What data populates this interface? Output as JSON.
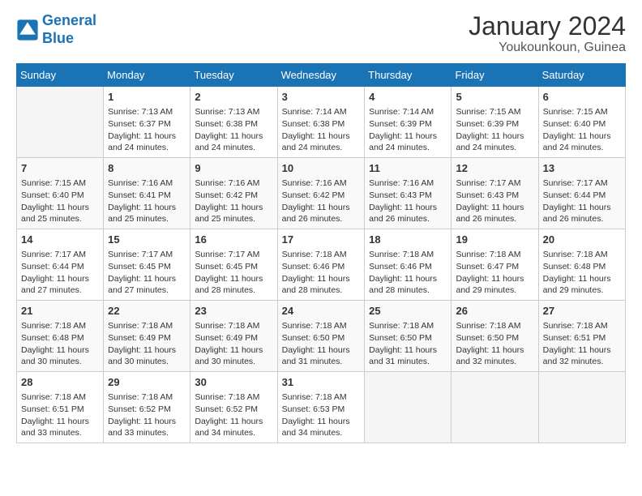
{
  "header": {
    "logo_line1": "General",
    "logo_line2": "Blue",
    "title": "January 2024",
    "subtitle": "Youkounkoun, Guinea"
  },
  "days_of_week": [
    "Sunday",
    "Monday",
    "Tuesday",
    "Wednesday",
    "Thursday",
    "Friday",
    "Saturday"
  ],
  "weeks": [
    [
      {
        "day": "",
        "sunrise": "",
        "sunset": "",
        "daylight": ""
      },
      {
        "day": "1",
        "sunrise": "Sunrise: 7:13 AM",
        "sunset": "Sunset: 6:37 PM",
        "daylight": "Daylight: 11 hours and 24 minutes."
      },
      {
        "day": "2",
        "sunrise": "Sunrise: 7:13 AM",
        "sunset": "Sunset: 6:38 PM",
        "daylight": "Daylight: 11 hours and 24 minutes."
      },
      {
        "day": "3",
        "sunrise": "Sunrise: 7:14 AM",
        "sunset": "Sunset: 6:38 PM",
        "daylight": "Daylight: 11 hours and 24 minutes."
      },
      {
        "day": "4",
        "sunrise": "Sunrise: 7:14 AM",
        "sunset": "Sunset: 6:39 PM",
        "daylight": "Daylight: 11 hours and 24 minutes."
      },
      {
        "day": "5",
        "sunrise": "Sunrise: 7:15 AM",
        "sunset": "Sunset: 6:39 PM",
        "daylight": "Daylight: 11 hours and 24 minutes."
      },
      {
        "day": "6",
        "sunrise": "Sunrise: 7:15 AM",
        "sunset": "Sunset: 6:40 PM",
        "daylight": "Daylight: 11 hours and 24 minutes."
      }
    ],
    [
      {
        "day": "7",
        "sunrise": "Sunrise: 7:15 AM",
        "sunset": "Sunset: 6:40 PM",
        "daylight": "Daylight: 11 hours and 25 minutes."
      },
      {
        "day": "8",
        "sunrise": "Sunrise: 7:16 AM",
        "sunset": "Sunset: 6:41 PM",
        "daylight": "Daylight: 11 hours and 25 minutes."
      },
      {
        "day": "9",
        "sunrise": "Sunrise: 7:16 AM",
        "sunset": "Sunset: 6:42 PM",
        "daylight": "Daylight: 11 hours and 25 minutes."
      },
      {
        "day": "10",
        "sunrise": "Sunrise: 7:16 AM",
        "sunset": "Sunset: 6:42 PM",
        "daylight": "Daylight: 11 hours and 26 minutes."
      },
      {
        "day": "11",
        "sunrise": "Sunrise: 7:16 AM",
        "sunset": "Sunset: 6:43 PM",
        "daylight": "Daylight: 11 hours and 26 minutes."
      },
      {
        "day": "12",
        "sunrise": "Sunrise: 7:17 AM",
        "sunset": "Sunset: 6:43 PM",
        "daylight": "Daylight: 11 hours and 26 minutes."
      },
      {
        "day": "13",
        "sunrise": "Sunrise: 7:17 AM",
        "sunset": "Sunset: 6:44 PM",
        "daylight": "Daylight: 11 hours and 26 minutes."
      }
    ],
    [
      {
        "day": "14",
        "sunrise": "Sunrise: 7:17 AM",
        "sunset": "Sunset: 6:44 PM",
        "daylight": "Daylight: 11 hours and 27 minutes."
      },
      {
        "day": "15",
        "sunrise": "Sunrise: 7:17 AM",
        "sunset": "Sunset: 6:45 PM",
        "daylight": "Daylight: 11 hours and 27 minutes."
      },
      {
        "day": "16",
        "sunrise": "Sunrise: 7:17 AM",
        "sunset": "Sunset: 6:45 PM",
        "daylight": "Daylight: 11 hours and 28 minutes."
      },
      {
        "day": "17",
        "sunrise": "Sunrise: 7:18 AM",
        "sunset": "Sunset: 6:46 PM",
        "daylight": "Daylight: 11 hours and 28 minutes."
      },
      {
        "day": "18",
        "sunrise": "Sunrise: 7:18 AM",
        "sunset": "Sunset: 6:46 PM",
        "daylight": "Daylight: 11 hours and 28 minutes."
      },
      {
        "day": "19",
        "sunrise": "Sunrise: 7:18 AM",
        "sunset": "Sunset: 6:47 PM",
        "daylight": "Daylight: 11 hours and 29 minutes."
      },
      {
        "day": "20",
        "sunrise": "Sunrise: 7:18 AM",
        "sunset": "Sunset: 6:48 PM",
        "daylight": "Daylight: 11 hours and 29 minutes."
      }
    ],
    [
      {
        "day": "21",
        "sunrise": "Sunrise: 7:18 AM",
        "sunset": "Sunset: 6:48 PM",
        "daylight": "Daylight: 11 hours and 30 minutes."
      },
      {
        "day": "22",
        "sunrise": "Sunrise: 7:18 AM",
        "sunset": "Sunset: 6:49 PM",
        "daylight": "Daylight: 11 hours and 30 minutes."
      },
      {
        "day": "23",
        "sunrise": "Sunrise: 7:18 AM",
        "sunset": "Sunset: 6:49 PM",
        "daylight": "Daylight: 11 hours and 30 minutes."
      },
      {
        "day": "24",
        "sunrise": "Sunrise: 7:18 AM",
        "sunset": "Sunset: 6:50 PM",
        "daylight": "Daylight: 11 hours and 31 minutes."
      },
      {
        "day": "25",
        "sunrise": "Sunrise: 7:18 AM",
        "sunset": "Sunset: 6:50 PM",
        "daylight": "Daylight: 11 hours and 31 minutes."
      },
      {
        "day": "26",
        "sunrise": "Sunrise: 7:18 AM",
        "sunset": "Sunset: 6:50 PM",
        "daylight": "Daylight: 11 hours and 32 minutes."
      },
      {
        "day": "27",
        "sunrise": "Sunrise: 7:18 AM",
        "sunset": "Sunset: 6:51 PM",
        "daylight": "Daylight: 11 hours and 32 minutes."
      }
    ],
    [
      {
        "day": "28",
        "sunrise": "Sunrise: 7:18 AM",
        "sunset": "Sunset: 6:51 PM",
        "daylight": "Daylight: 11 hours and 33 minutes."
      },
      {
        "day": "29",
        "sunrise": "Sunrise: 7:18 AM",
        "sunset": "Sunset: 6:52 PM",
        "daylight": "Daylight: 11 hours and 33 minutes."
      },
      {
        "day": "30",
        "sunrise": "Sunrise: 7:18 AM",
        "sunset": "Sunset: 6:52 PM",
        "daylight": "Daylight: 11 hours and 34 minutes."
      },
      {
        "day": "31",
        "sunrise": "Sunrise: 7:18 AM",
        "sunset": "Sunset: 6:53 PM",
        "daylight": "Daylight: 11 hours and 34 minutes."
      },
      {
        "day": "",
        "sunrise": "",
        "sunset": "",
        "daylight": ""
      },
      {
        "day": "",
        "sunrise": "",
        "sunset": "",
        "daylight": ""
      },
      {
        "day": "",
        "sunrise": "",
        "sunset": "",
        "daylight": ""
      }
    ]
  ]
}
